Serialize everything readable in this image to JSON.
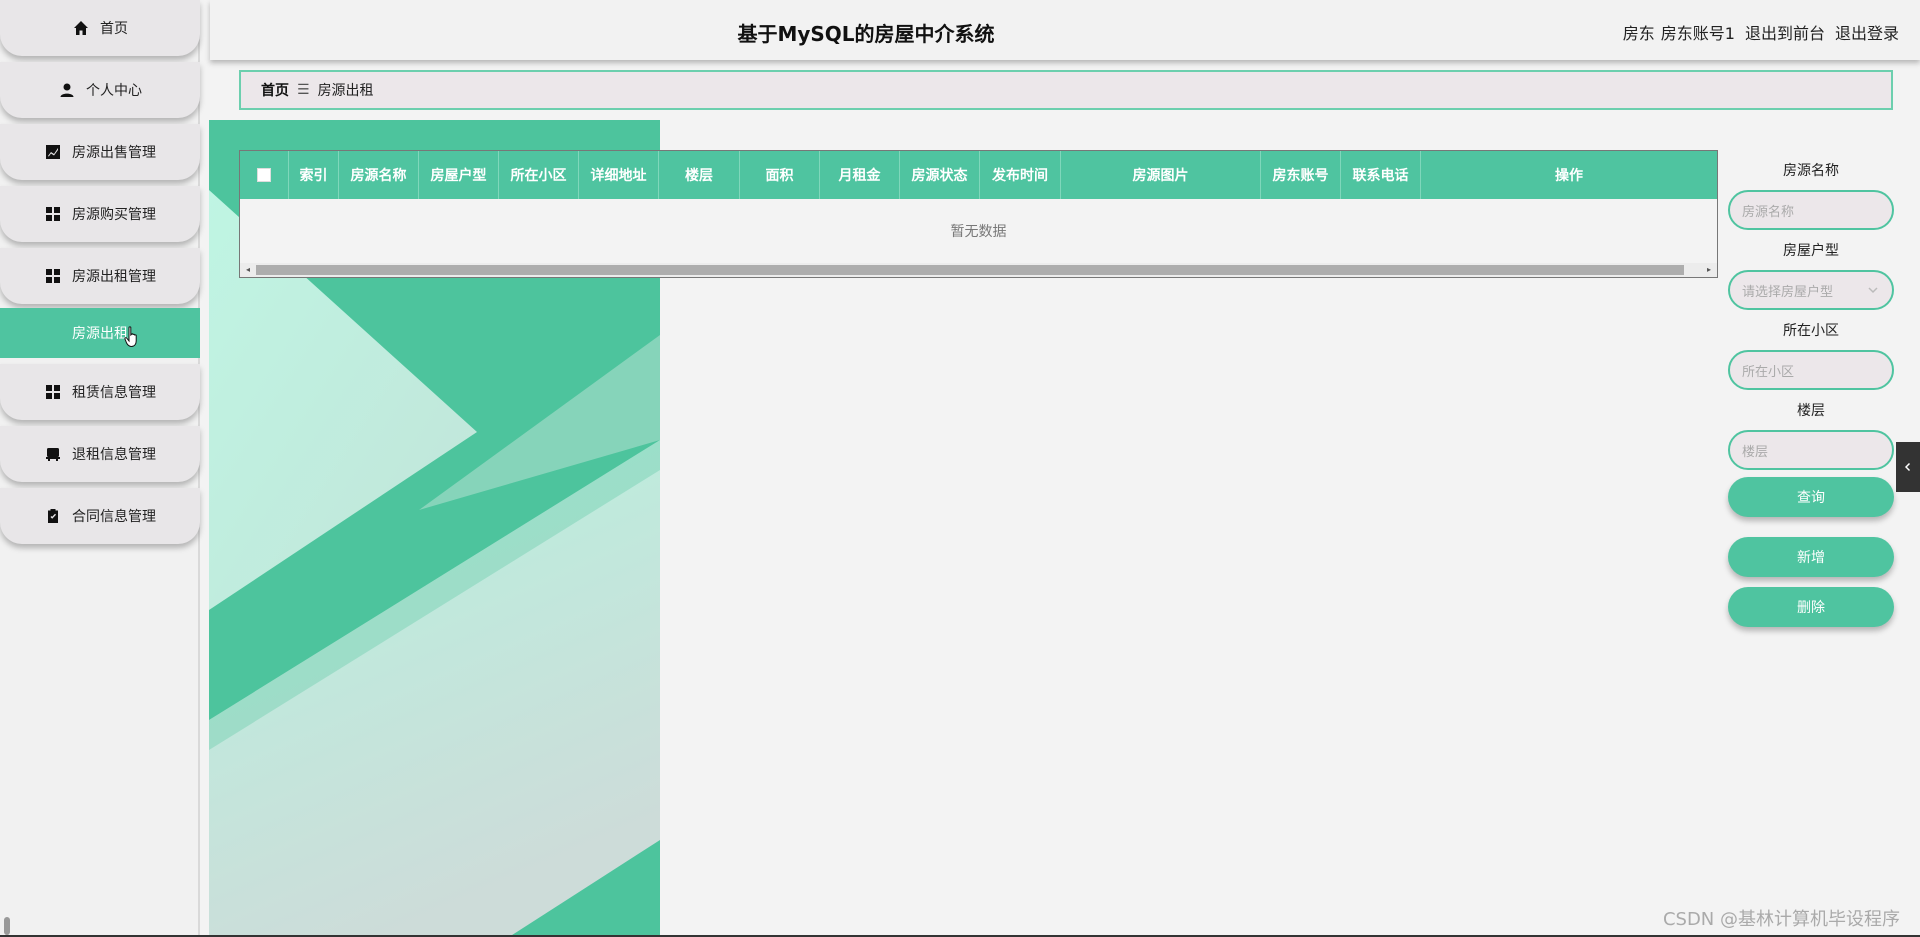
{
  "app": {
    "title": "基于MySQL的房屋中介系统"
  },
  "header": {
    "user_role": "房东",
    "user_account": "房东账号1",
    "goto_front": "退出到前台",
    "logout": "退出登录"
  },
  "sidebar": {
    "items": [
      {
        "label": "首页",
        "icon": "home-icon"
      },
      {
        "label": "个人中心",
        "icon": "person-icon"
      },
      {
        "label": "房源出售管理",
        "icon": "chart-icon"
      },
      {
        "label": "房源购买管理",
        "icon": "grid-icon"
      },
      {
        "label": "房源出租管理",
        "icon": "grid-icon"
      },
      {
        "label": "房源出租",
        "icon": ""
      },
      {
        "label": "租赁信息管理",
        "icon": "grid-icon"
      },
      {
        "label": "退租信息管理",
        "icon": "desk-icon"
      },
      {
        "label": "合同信息管理",
        "icon": "clipboard-icon"
      }
    ],
    "active_index": 5
  },
  "breadcrumb": {
    "home": "首页",
    "separator": "☰",
    "current": "房源出租"
  },
  "table": {
    "columns": [
      "",
      "索引",
      "房源名称",
      "房屋户型",
      "所在小区",
      "详细地址",
      "楼层",
      "面积",
      "月租金",
      "房源状态",
      "发布时间",
      "房源图片",
      "房东账号",
      "联系电话",
      "操作"
    ],
    "empty_text": "暂无数据"
  },
  "search": {
    "name_label": "房源名称",
    "name_placeholder": "房源名称",
    "type_label": "房屋户型",
    "type_placeholder": "请选择房屋户型",
    "community_label": "所在小区",
    "community_placeholder": "所在小区",
    "floor_label": "楼层",
    "floor_placeholder": "楼层",
    "query_button": "查询",
    "add_button": "新增",
    "delete_button": "删除"
  },
  "watermark": "CSDN @基林计算机毕设程序",
  "colors": {
    "accent": "#4fc4a0",
    "sidebar_bg": "#e8e6e8",
    "breadcrumb_bg": "#ece7ea"
  }
}
